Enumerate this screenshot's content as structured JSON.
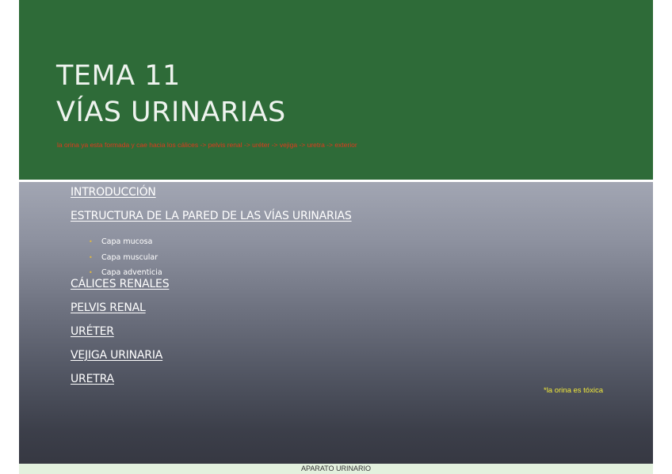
{
  "header": {
    "title_line1": "TEMA 11",
    "title_line2": "VÍAS URINARIAS",
    "note": "la orina ya esta formada y cae hacia los cálices -> pelvis renal -> uréter -> vejiga -> uretra -> exterior",
    "background_color": "#2e6b38",
    "note_color": "#e03a1c"
  },
  "topics": [
    {
      "label": "INTRODUCCIÓN"
    },
    {
      "label": "ESTRUCTURA DE  LA PARED DE  LAS VÍAS URINARIAS"
    },
    {
      "label": "CÁLICES RENALES"
    },
    {
      "label": "PELVIS RENAL"
    },
    {
      "label": "URÉTER"
    },
    {
      "label": "VEJIGA URINARIA"
    },
    {
      "label": "URETRA"
    }
  ],
  "subtopics": [
    {
      "bullet": "•",
      "label": "Capa mucosa"
    },
    {
      "bullet": "•",
      "label": "Capa muscular"
    },
    {
      "bullet": "•",
      "label": "Capa adventicia"
    }
  ],
  "side_note": {
    "text": "*la orina es tóxica",
    "color": "#f2ea3a"
  },
  "footer": {
    "text": "APARATO URINARIO",
    "background_color": "#e3f1de"
  }
}
